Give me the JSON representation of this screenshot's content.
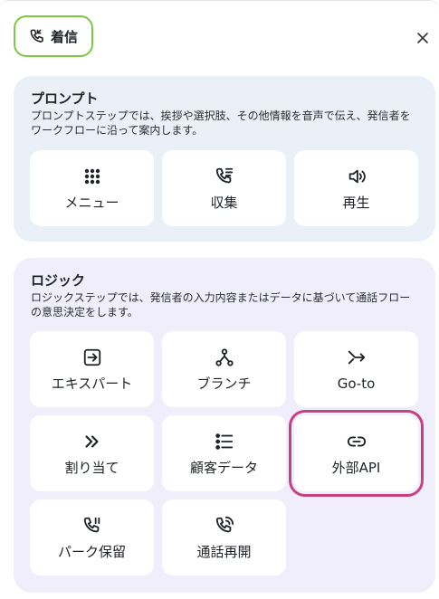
{
  "header": {
    "pill_label": "着信",
    "pill_icon": "phone-incoming-icon",
    "close_icon": "close-icon"
  },
  "prompt": {
    "title": "プロンプト",
    "description": "プロンプトステップでは、挨拶や選択肢、その他情報を音声で伝え、発信者をワークフローに沿って案内します。",
    "items": [
      {
        "label": "メニュー",
        "icon": "grid-dots-icon"
      },
      {
        "label": "収集",
        "icon": "phone-collect-icon"
      },
      {
        "label": "再生",
        "icon": "speaker-icon"
      }
    ]
  },
  "logic": {
    "title": "ロジック",
    "description": "ロジックステップでは、発信者の入力内容またはデータに基づいて通話フローの意思決定をします。",
    "items": [
      {
        "label": "エキスパート",
        "icon": "export-icon"
      },
      {
        "label": "ブランチ",
        "icon": "branch-icon"
      },
      {
        "label": "Go-to",
        "icon": "goto-arrow-icon"
      },
      {
        "label": "割り当て",
        "icon": "double-chevron-icon"
      },
      {
        "label": "顧客データ",
        "icon": "list-icon"
      },
      {
        "label": "外部API",
        "icon": "link-icon"
      },
      {
        "label": "パーク保留",
        "icon": "phone-park-icon"
      },
      {
        "label": "通話再開",
        "icon": "phone-resume-icon"
      }
    ]
  },
  "colors": {
    "pill_border": "#7ac943",
    "prompt_bg": "#e9f0f8",
    "logic_bg": "#f0eefb",
    "highlight": "#c8407f"
  }
}
